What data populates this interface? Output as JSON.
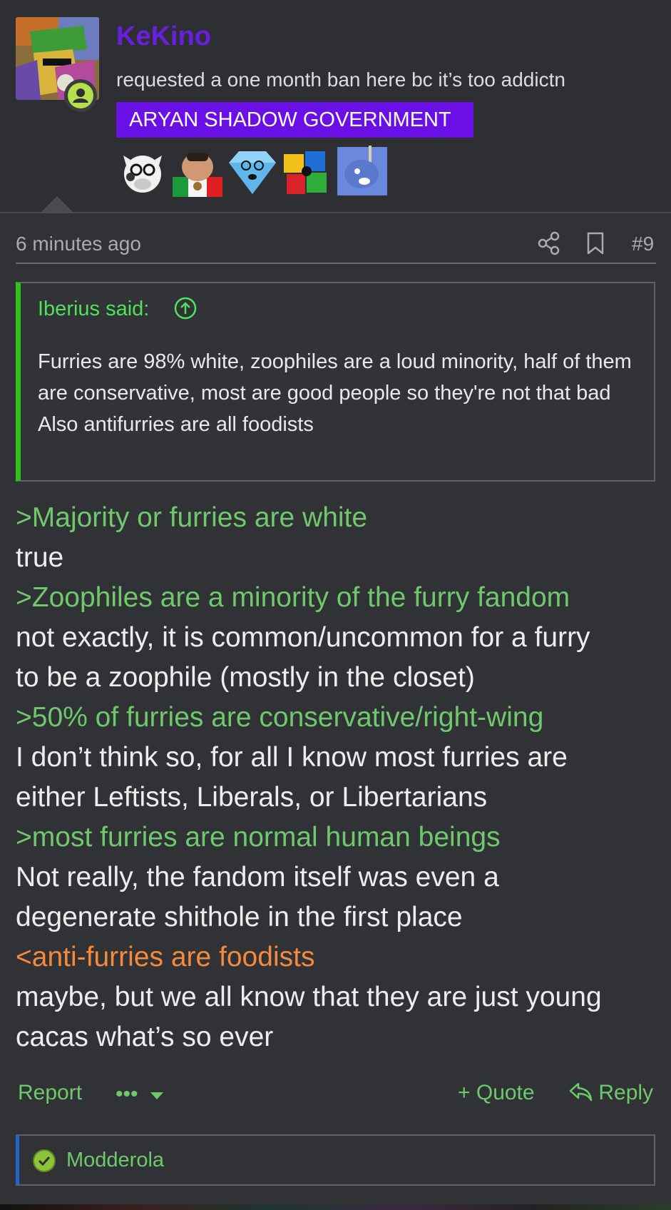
{
  "user": {
    "name": "KeKino",
    "title": "requested a one month ban here bc it’s too addictn",
    "banner": "ARYAN SHADOW GOVERNMENT",
    "avatar_icon": "avatar-pixel-art",
    "status_icon": "user-online-icon",
    "badges": [
      "cow-glasses-badge-icon",
      "mexico-flag-man-badge-icon",
      "diamond-wojak-badge-icon",
      "puzzle-pieces-badge-icon",
      "blue-creature-noose-badge-icon"
    ]
  },
  "post": {
    "time": "6 minutes ago",
    "number": "#9",
    "share_icon": "share-icon",
    "bookmark_icon": "bookmark-icon"
  },
  "quote": {
    "head": "Iberius said:",
    "body": [
      "Furries are 98% white, zoophiles are a loud minority, half of them are conservative, most are good people so they're not that bad",
      "Also antifurries are all foodists"
    ]
  },
  "content": [
    {
      "type": "greentext",
      "text": ">Majority or furries are white"
    },
    {
      "type": "plain",
      "text": "true"
    },
    {
      "type": "greentext",
      "text": ">Zoophiles are a minority of the furry fandom"
    },
    {
      "type": "plain",
      "text": "not exactly, it is common/uncommon for a furry"
    },
    {
      "type": "plain",
      "text": "to be a zoophile (mostly in the closet)"
    },
    {
      "type": "greentext",
      "text": ">50% of furries are conservative/right-wing"
    },
    {
      "type": "plain",
      "text": "I don’t think so, for all I know most furries are"
    },
    {
      "type": "plain",
      "text": "either Leftists, Liberals, or Libertarians"
    },
    {
      "type": "greentext",
      "text": ">most furries are normal human beings"
    },
    {
      "type": "plain",
      "text": "Not really, the fandom itself was even a"
    },
    {
      "type": "plain",
      "text": "degenerate shithole in the first place"
    },
    {
      "type": "orangetext",
      "text": "<anti-furries are foodists"
    },
    {
      "type": "plain",
      "text": "maybe, but we all know that they are just young"
    },
    {
      "type": "plain",
      "text": "cacas what’s so ever"
    }
  ],
  "actions": {
    "report": "Report",
    "more": "•••",
    "quote": "+ Quote",
    "reply": "Reply"
  },
  "reactions": {
    "mod_name": "Modderola"
  },
  "colors": {
    "background": "#303236",
    "greentext": "#6fc96c",
    "orangetext": "#f58a3d",
    "username": "#6a1ee0",
    "banner": "#6a10e6",
    "quote_border": "#2ec31a"
  }
}
